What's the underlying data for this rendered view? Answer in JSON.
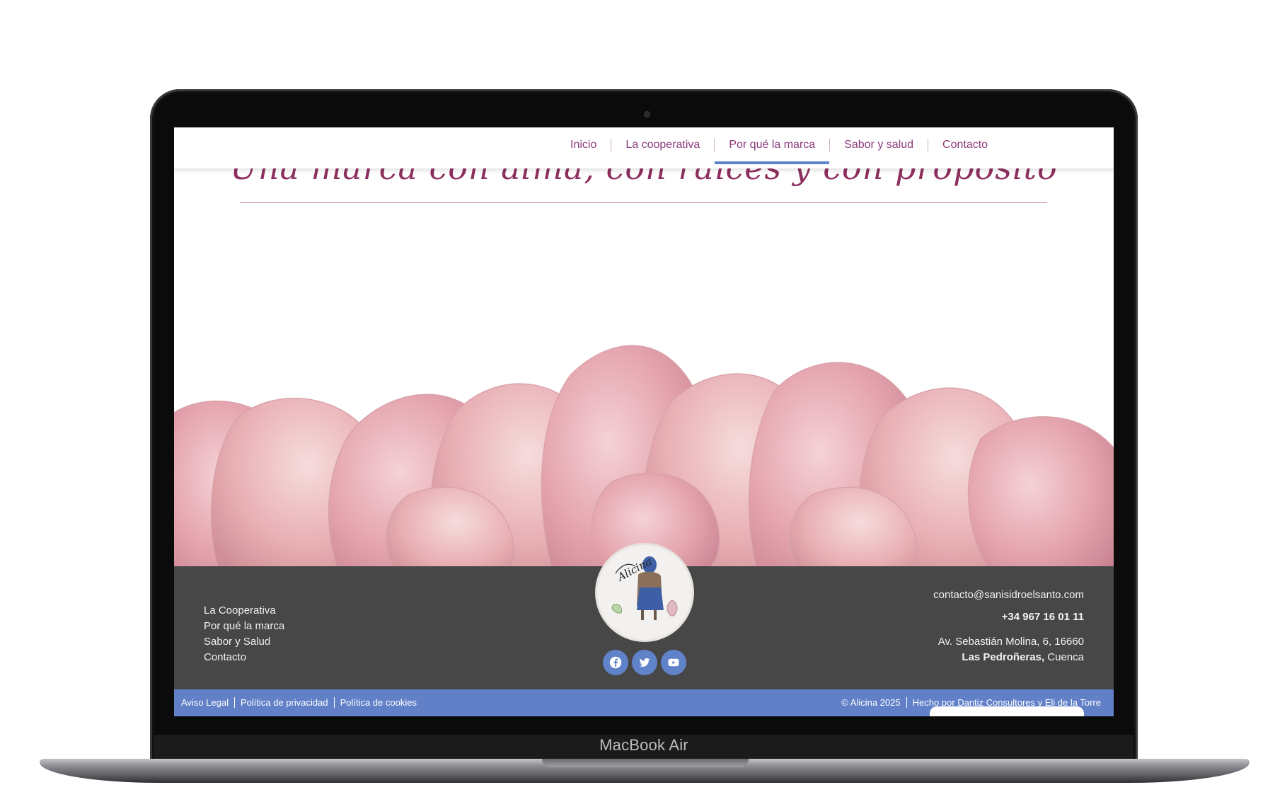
{
  "device": {
    "model_label": "MacBook Air"
  },
  "nav": {
    "items": [
      {
        "label": "Inicio"
      },
      {
        "label": "La cooperativa"
      },
      {
        "label": "Por qué la marca",
        "active": true
      },
      {
        "label": "Sabor y salud"
      },
      {
        "label": "Contacto"
      }
    ]
  },
  "hero": {
    "heading": "Una marca con alma, con raíces y con propósito"
  },
  "footer": {
    "links": [
      "La Cooperativa",
      "Por qué la marca",
      "Sabor y Salud",
      "Contacto"
    ],
    "logo_text": "Alicina",
    "social": [
      "facebook-icon",
      "twitter-icon",
      "youtube-icon"
    ],
    "email": "contacto@sanisidroelsanto.com",
    "phone": "+34 967 16 01 11",
    "address_line1": "Av. Sebastián Molina, 6, 16660",
    "address_town_bold": "Las Pedroñeras,",
    "address_town_rest": " Cuenca"
  },
  "legal": {
    "left": [
      "Aviso Legal",
      "Política de privacidad",
      "Política de cookies"
    ],
    "copyright": "© Alicina 2025",
    "credits": "Hecho por Dantiz Consultores y Eli de la Torre"
  },
  "colors": {
    "accent_purple": "#8a3a7b",
    "accent_blue": "#6180c8",
    "footer_bg": "#474747"
  }
}
